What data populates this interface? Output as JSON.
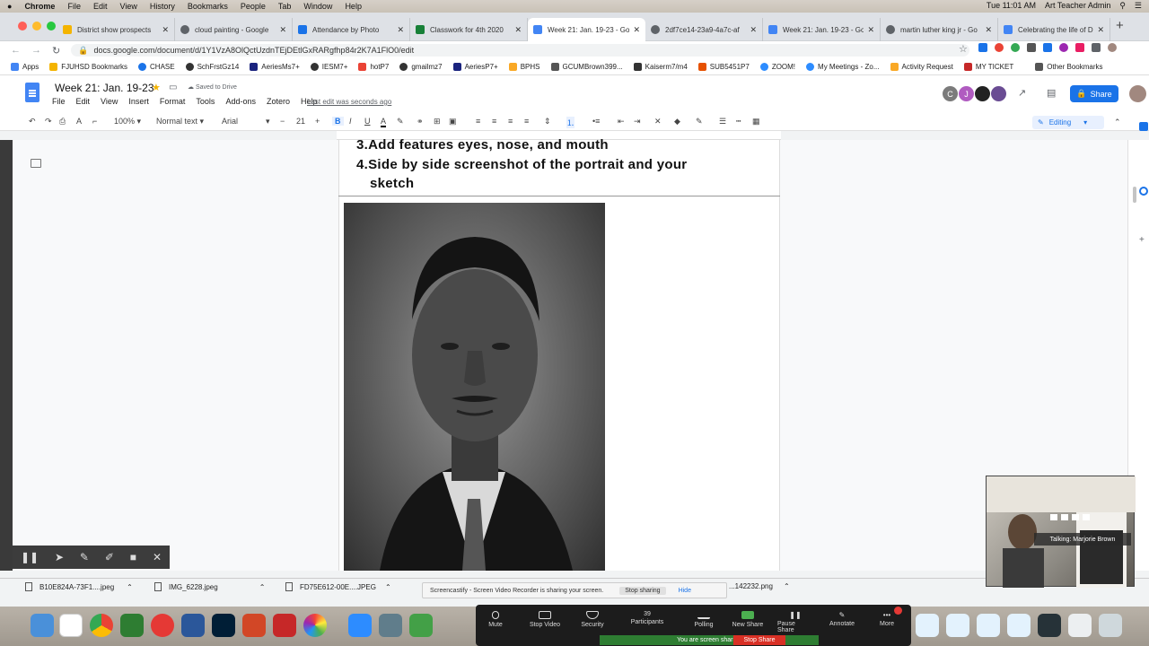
{
  "menubar": {
    "app": "Chrome",
    "items": [
      "File",
      "Edit",
      "View",
      "History",
      "Bookmarks",
      "People",
      "Tab",
      "Window",
      "Help"
    ],
    "clock": "Tue 11:01 AM",
    "user": "Art Teacher Admin"
  },
  "tabs": [
    {
      "label": "District show prospects",
      "color": "#f4b400"
    },
    {
      "label": "cloud painting - Google",
      "color": "#5f6368"
    },
    {
      "label": "Attendance by Photo",
      "color": "#1a73e8"
    },
    {
      "label": "Classwork for 4th 2020",
      "color": "#188038"
    },
    {
      "label": "Week 21: Jan. 19-23 - Go",
      "color": "#4285f4"
    },
    {
      "label": "2df7ce14-23a9-4a7c-af",
      "color": "#5f6368"
    },
    {
      "label": "Week 21: Jan. 19-23 - Go",
      "color": "#4285f4"
    },
    {
      "label": "martin luther king jr - Go",
      "color": "#5f6368"
    },
    {
      "label": "Celebrating the life of Dr.",
      "color": "#4285f4"
    }
  ],
  "address": {
    "url": "docs.google.com/document/d/1Y1VzA8OlQctUzdnTEjDEtlGxRARgfhp84r2K7A1FlO0/edit"
  },
  "bookmarks": [
    {
      "label": "Apps",
      "color": "#4285f4"
    },
    {
      "label": "FJUHSD Bookmarks",
      "color": "#f4b400"
    },
    {
      "label": "CHASE",
      "color": "#1a73e8"
    },
    {
      "label": "SchFrstGz14",
      "color": "#333333"
    },
    {
      "label": "AeriesMs7+",
      "color": "#1a237e"
    },
    {
      "label": "IESM7+",
      "color": "#333333"
    },
    {
      "label": "hotP7",
      "color": "#ea4335"
    },
    {
      "label": "gmailmz7",
      "color": "#333333"
    },
    {
      "label": "AeriesP7+",
      "color": "#1a237e"
    },
    {
      "label": "BPHS",
      "color": "#f9a825"
    },
    {
      "label": "GCUMBrown399...",
      "color": "#555555"
    },
    {
      "label": "Kaiserm7/m4",
      "color": "#333333"
    },
    {
      "label": "SUB5451P7",
      "color": "#e65100"
    },
    {
      "label": "ZOOM!",
      "color": "#2d8cff"
    },
    {
      "label": "My Meetings - Zo...",
      "color": "#2d8cff"
    },
    {
      "label": "Activity Request",
      "color": "#f9a825"
    },
    {
      "label": "MY TICKET",
      "color": "#c62828"
    },
    {
      "label": "Other Bookmarks",
      "color": "#555555"
    }
  ],
  "doc": {
    "title": "Week 21: Jan. 19-23",
    "saved": "Saved to Drive",
    "menu": [
      "File",
      "Edit",
      "View",
      "Insert",
      "Format",
      "Tools",
      "Add-ons",
      "Zotero",
      "Help"
    ],
    "last_edit": "Last edit was seconds ago",
    "share": "Share",
    "avatars": [
      {
        "letter": "C",
        "color": "#7b7b7b"
      },
      {
        "letter": "J",
        "color": "#b05bc0"
      },
      {
        "letter": "",
        "color": "#222222"
      },
      {
        "letter": "",
        "color": "#6a4c93"
      }
    ]
  },
  "toolbar": {
    "zoom": "100%",
    "style": "Normal text",
    "font": "Arial",
    "size": "21",
    "mode": "Editing"
  },
  "content": {
    "item3_num": "3.",
    "item3_text": "Add features eyes, nose, and mouth",
    "item4_num": "4.",
    "item4_text_a": "Side by side screenshot of the portrait and your",
    "item4_text_b": "sketch"
  },
  "downloads": [
    {
      "name": "B10E824A-73F1....jpeg"
    },
    {
      "name": "IMG_6228.jpeg"
    },
    {
      "name": "FD75E612-00E....JPEG"
    },
    {
      "name": "...142232.png"
    }
  ],
  "screencastify": {
    "message": "Screencastify - Screen Video Recorder is sharing your screen.",
    "stop": "Stop sharing",
    "hide": "Hide"
  },
  "zoom": {
    "buttons": [
      "Mute",
      "Stop Video",
      "Security",
      "Participants",
      "Polling",
      "New Share",
      "Pause Share",
      "Annotate",
      "More"
    ],
    "participants_count": "39",
    "sharing_notice": "You are screen sharing",
    "stop_share": "Stop Share",
    "talking": "Talking: Marjorie Brown"
  }
}
